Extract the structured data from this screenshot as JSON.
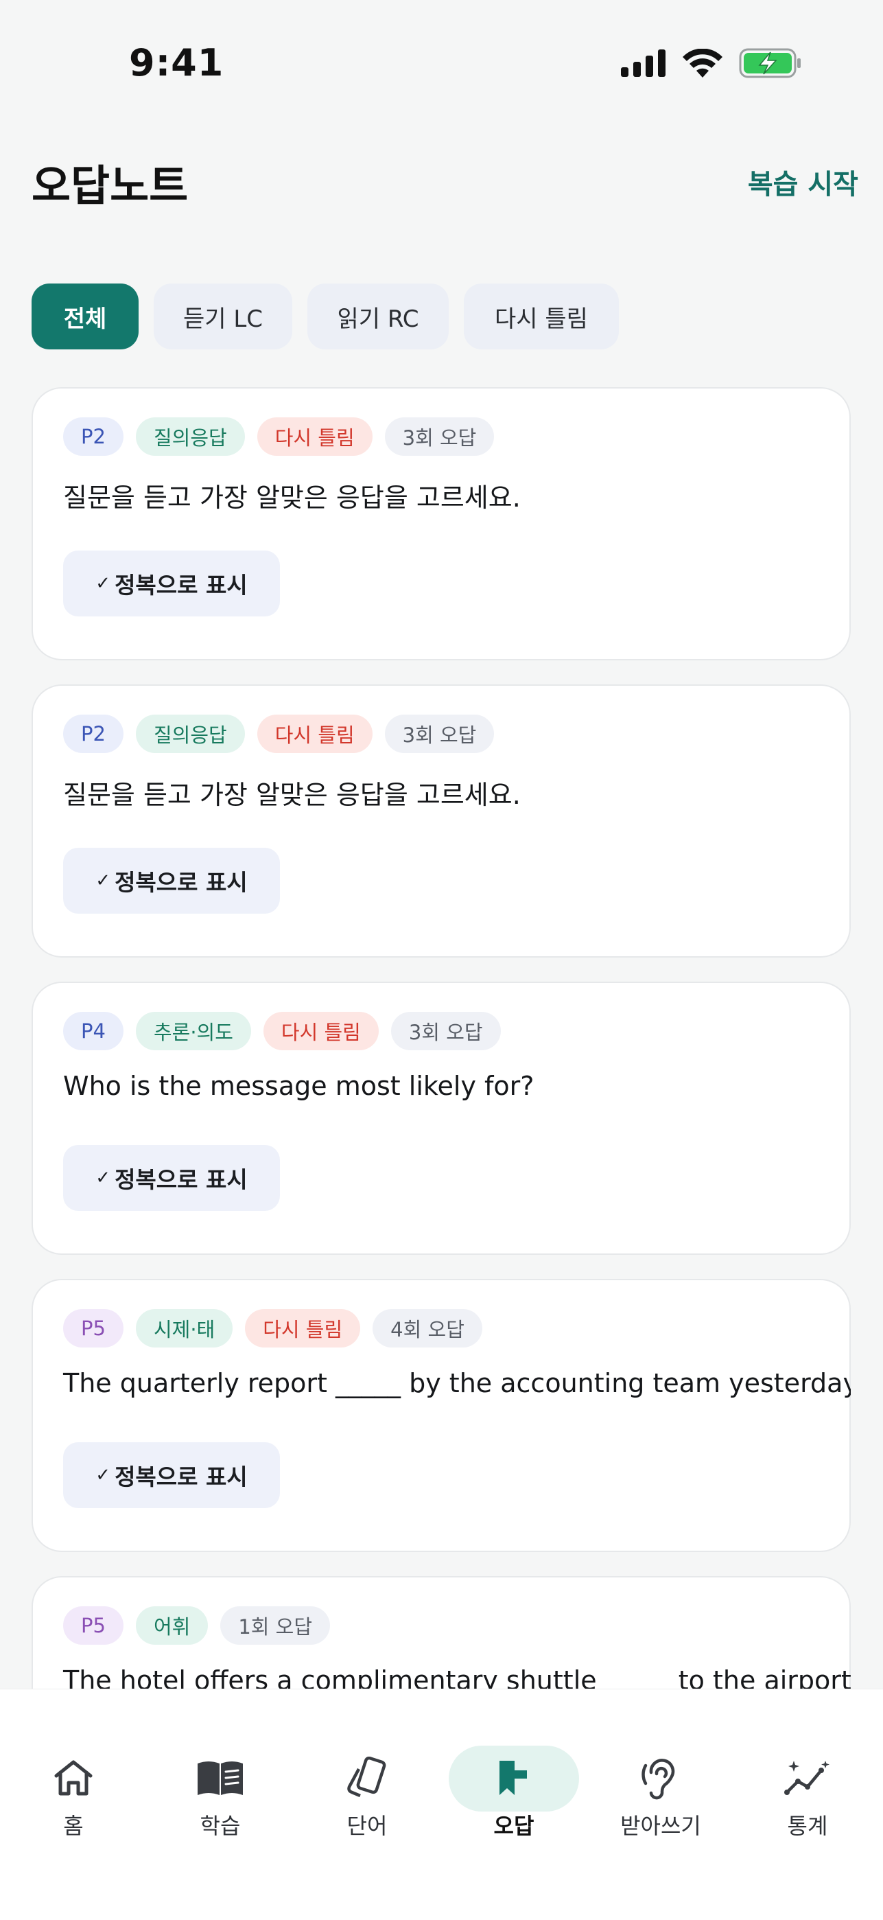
{
  "status_bar": {
    "time": "9:41",
    "icons": [
      "signal-icon",
      "wifi-icon",
      "battery-charging-icon"
    ]
  },
  "header": {
    "title": "오답노트",
    "action": "복습 시작"
  },
  "filters": [
    {
      "label": "전체",
      "active": true
    },
    {
      "label": "듣기 LC",
      "active": false
    },
    {
      "label": "읽기 RC",
      "active": false
    },
    {
      "label": "다시 틀림",
      "active": false
    }
  ],
  "cards": [
    {
      "part": "P2",
      "category": "질의응답",
      "status": "다시 틀림",
      "count": "3회 오답",
      "question": "질문을 듣고 가장 알맞은 응답을 고르세요.",
      "button": "정복으로 표시",
      "check": "✓"
    },
    {
      "part": "P2",
      "category": "질의응답",
      "status": "다시 틀림",
      "count": "3회 오답",
      "question": "질문을 듣고 가장 알맞은 응답을 고르세요.",
      "button": "정복으로 표시",
      "check": "✓"
    },
    {
      "part": "P4",
      "category": "추론·의도",
      "status": "다시 틀림",
      "count": "3회 오답",
      "question": "Who is the message most likely for?",
      "button": "정복으로 표시",
      "check": "✓"
    },
    {
      "part": "P5",
      "category": "시제·태",
      "status": "다시 틀림",
      "count": "4회 오답",
      "question": "The quarterly report _____ by the accounting team yesterday.",
      "button": "정복으로 표시",
      "check": "✓"
    },
    {
      "part": "P5",
      "category": "어휘",
      "count": "1회 오답",
      "question": "The hotel offers a complimentary shuttle _____ to the airport"
    }
  ],
  "nav": [
    {
      "label": "홈",
      "icon": "home-icon"
    },
    {
      "label": "학습",
      "icon": "book-icon"
    },
    {
      "label": "단어",
      "icon": "cards-icon"
    },
    {
      "label": "오답",
      "icon": "bookmark-flag-icon",
      "active": true
    },
    {
      "label": "받아쓰기",
      "icon": "ear-icon"
    },
    {
      "label": "통계",
      "icon": "stats-sparkle-icon"
    }
  ],
  "colors": {
    "accent": "#13786c",
    "danger": "#d2372b",
    "background": "#f5f6f6"
  }
}
